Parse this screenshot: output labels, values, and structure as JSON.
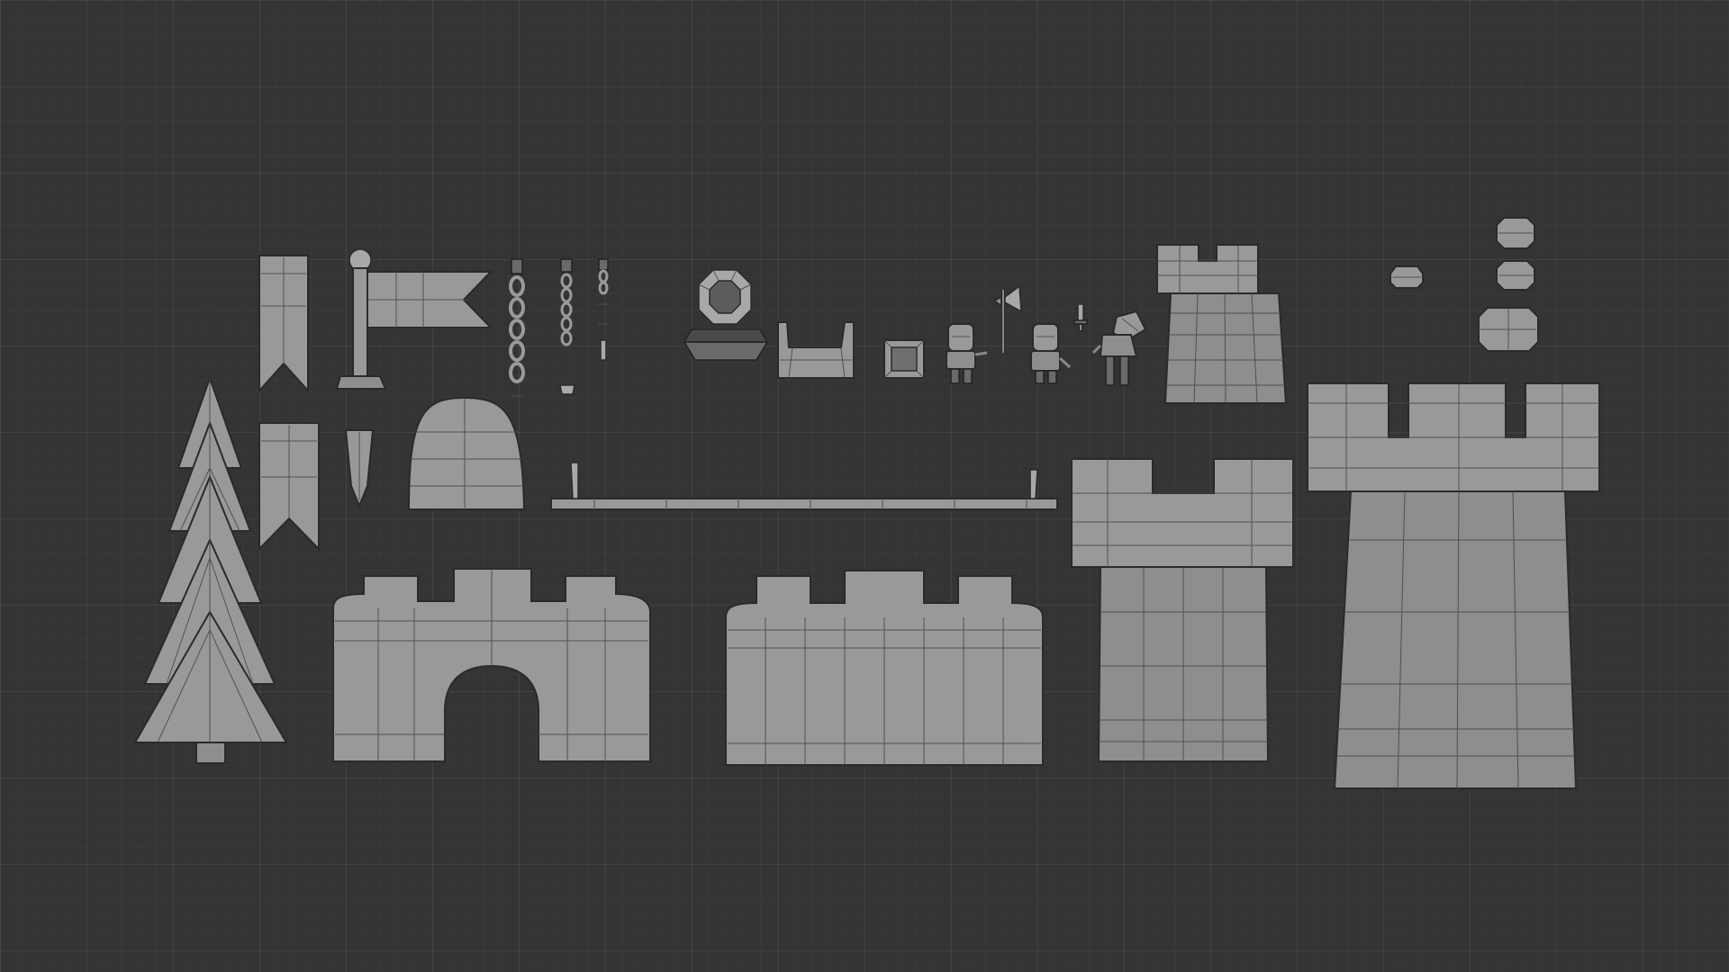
{
  "viewport": {
    "background_color": "#343434",
    "grid_color": "#3e3e3e",
    "mesh_color": "#8e8e8e",
    "wire_color": "#2a2a2a"
  },
  "assets": [
    {
      "name": "banner-long"
    },
    {
      "name": "flag-pole"
    },
    {
      "name": "chain-long"
    },
    {
      "name": "chain-medium"
    },
    {
      "name": "chain-short"
    },
    {
      "name": "brazier"
    },
    {
      "name": "cart-tray"
    },
    {
      "name": "crate"
    },
    {
      "name": "knight-1"
    },
    {
      "name": "axe"
    },
    {
      "name": "knight-2"
    },
    {
      "name": "sword"
    },
    {
      "name": "knight-3"
    },
    {
      "name": "tower-small"
    },
    {
      "name": "stone-small"
    },
    {
      "name": "stones-stack"
    },
    {
      "name": "tower-large"
    },
    {
      "name": "pine-tree"
    },
    {
      "name": "banner-short"
    },
    {
      "name": "pennant"
    },
    {
      "name": "rock-dome"
    },
    {
      "name": "wall-rail"
    },
    {
      "name": "tower-medium"
    },
    {
      "name": "gate-wall"
    },
    {
      "name": "wall-segment"
    }
  ]
}
